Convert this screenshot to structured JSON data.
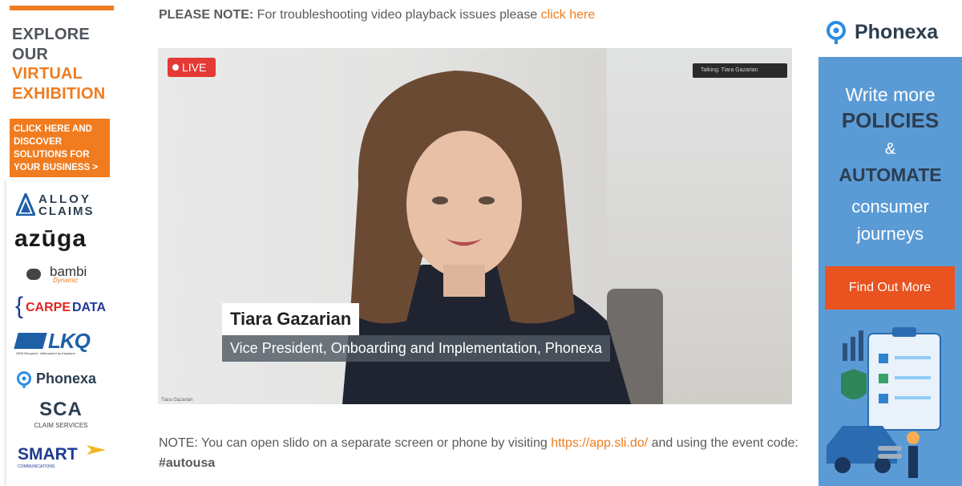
{
  "sidebar": {
    "explore_1": "EXPLORE",
    "explore_2": "OUR",
    "explore_3": "VIRTUAL",
    "explore_4": "EXHIBITION",
    "cta_lines": [
      "CLICK HERE AND",
      "DISCOVER",
      "SOLUTIONS FOR",
      "YOUR BUSINESS >"
    ],
    "logos": {
      "alloy_1": "ALLOY",
      "alloy_2": "CLAIMS",
      "azuga": "azūga",
      "bambi": "bambi",
      "bambi_sub": "Dynamic",
      "carpe_brace": "{",
      "carpe": "CARPE",
      "carpe_data": "DATA",
      "lkq": "LKQ",
      "lkq_sub": "OEM Recycled · Aftermarket by Keystone",
      "phonexa": "Phonexa",
      "sca": "SCA",
      "sca_sub": "CLAIM SERVICES",
      "smart": "SMART",
      "smart_sub": "COMMUNICATIONS"
    }
  },
  "main": {
    "note_top_bold": "PLEASE NOTE:",
    "note_top_text": " For troubleshooting video playback issues please ",
    "note_top_link": "click here",
    "video": {
      "live_label": "LIVE",
      "talking_label": "Talking: Tiara Gazarian",
      "speaker_name": "Tiara Gazarian",
      "speaker_title": "Vice President, Onboarding and Implementation, Phonexa",
      "footer_label": "Tiara Gazarian"
    },
    "note_bottom_text": "NOTE: You can open slido on a separate screen or phone by visiting ",
    "note_bottom_link": "https://app.sli.do/",
    "note_bottom_text2": " and using the event code: ",
    "note_bottom_code": "#autousa"
  },
  "ad": {
    "brand": "Phonexa",
    "line1": "Write more",
    "line2": "POLICIES",
    "line3": "&",
    "line4": "AUTOMATE",
    "line5": "consumer",
    "line6": "journeys",
    "button": "Find Out More"
  },
  "colors": {
    "accent_orange": "#f07c1f",
    "ad_blue": "#5b9bd5",
    "ad_button": "#e8531f",
    "live_red": "#e53935"
  }
}
